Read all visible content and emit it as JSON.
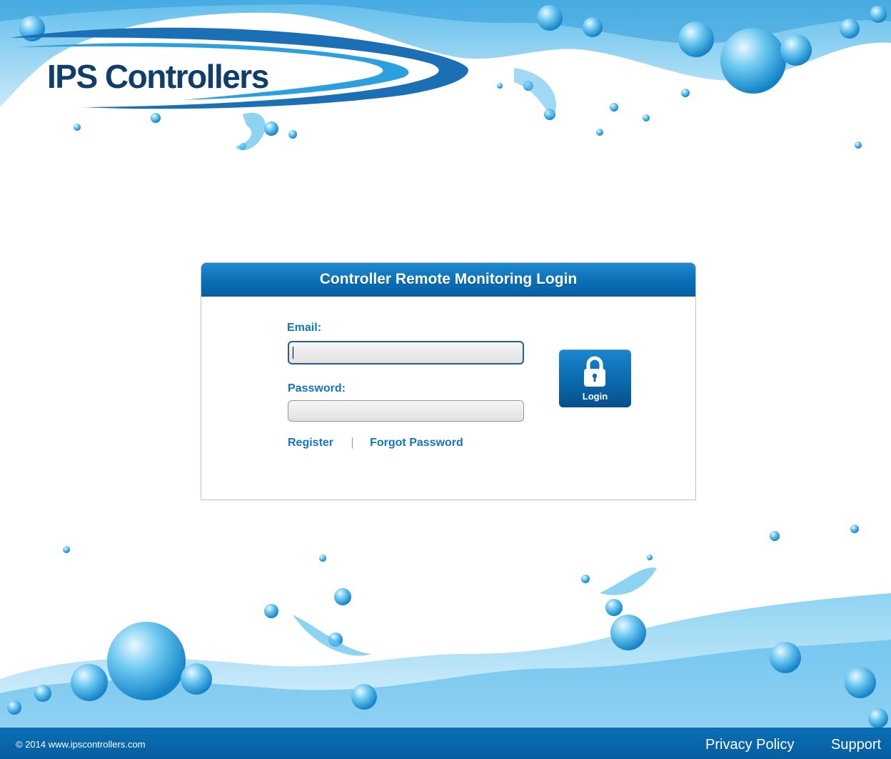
{
  "brand": {
    "name": "IPS Controllers",
    "colors": {
      "primary": "#0b6fb5",
      "dark": "#0f3e6b",
      "link": "#1375bd",
      "water": "#5fc0ee"
    }
  },
  "login": {
    "title": "Controller Remote Monitoring Login",
    "email_label": "Email:",
    "email_value": "",
    "password_label": "Password:",
    "password_value": "",
    "login_button_label": "Login",
    "login_icon": "lock-icon",
    "register_link": "Register",
    "link_separator": "|",
    "forgot_password_link": "Forgot Password"
  },
  "footer": {
    "copyright": "© 2014 www.ipscontrollers.com",
    "privacy_link": "Privacy Policy",
    "support_link": "Support"
  }
}
